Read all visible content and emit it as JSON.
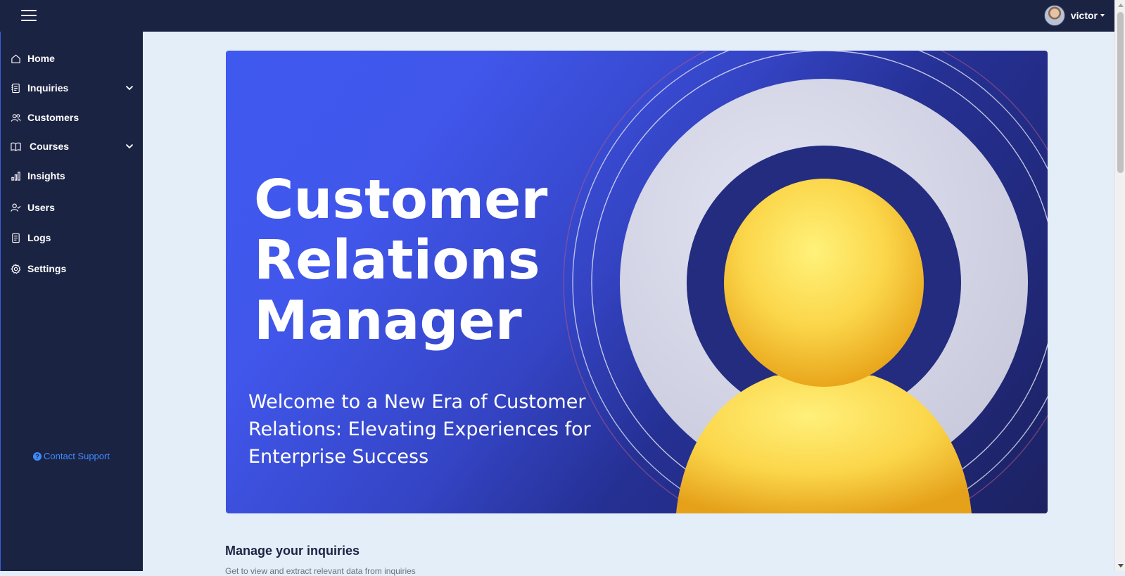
{
  "topbar": {
    "menu_icon": "hamburger-icon",
    "user": {
      "name": "victor",
      "avatar_icon": "user-avatar"
    }
  },
  "sidebar": {
    "items": [
      {
        "label": "Home",
        "icon": "home-icon"
      },
      {
        "label": "Inquiries",
        "icon": "inquiries-icon",
        "expandable": true
      },
      {
        "label": "Customers",
        "icon": "customers-icon"
      },
      {
        "label": "Courses",
        "icon": "book-icon",
        "expandable": true
      },
      {
        "label": "Insights",
        "icon": "bar-chart-icon"
      },
      {
        "label": "Users",
        "icon": "user-check-icon"
      },
      {
        "label": "Logs",
        "icon": "logs-icon"
      },
      {
        "label": "Settings",
        "icon": "gear-icon"
      }
    ],
    "support": {
      "label": "Contact Support",
      "icon": "help-circle-icon"
    }
  },
  "hero": {
    "title_lines": [
      "Customer",
      "Relations",
      "Manager"
    ],
    "subtitle": "Welcome to a New Era of Customer Relations: Elevating Experiences for Enterprise Success",
    "illustration": "person-avatar-illustration"
  },
  "section": {
    "title": "Manage your inquiries",
    "subtitle": "Get to view and extract relevant data from inquiries"
  },
  "colors": {
    "sidebar_bg": "#1b2343",
    "page_bg": "#e3eef8",
    "hero_blue": "#4157ec",
    "link_blue": "#3d8bfd",
    "figure_yellow": "#fbd64a"
  }
}
